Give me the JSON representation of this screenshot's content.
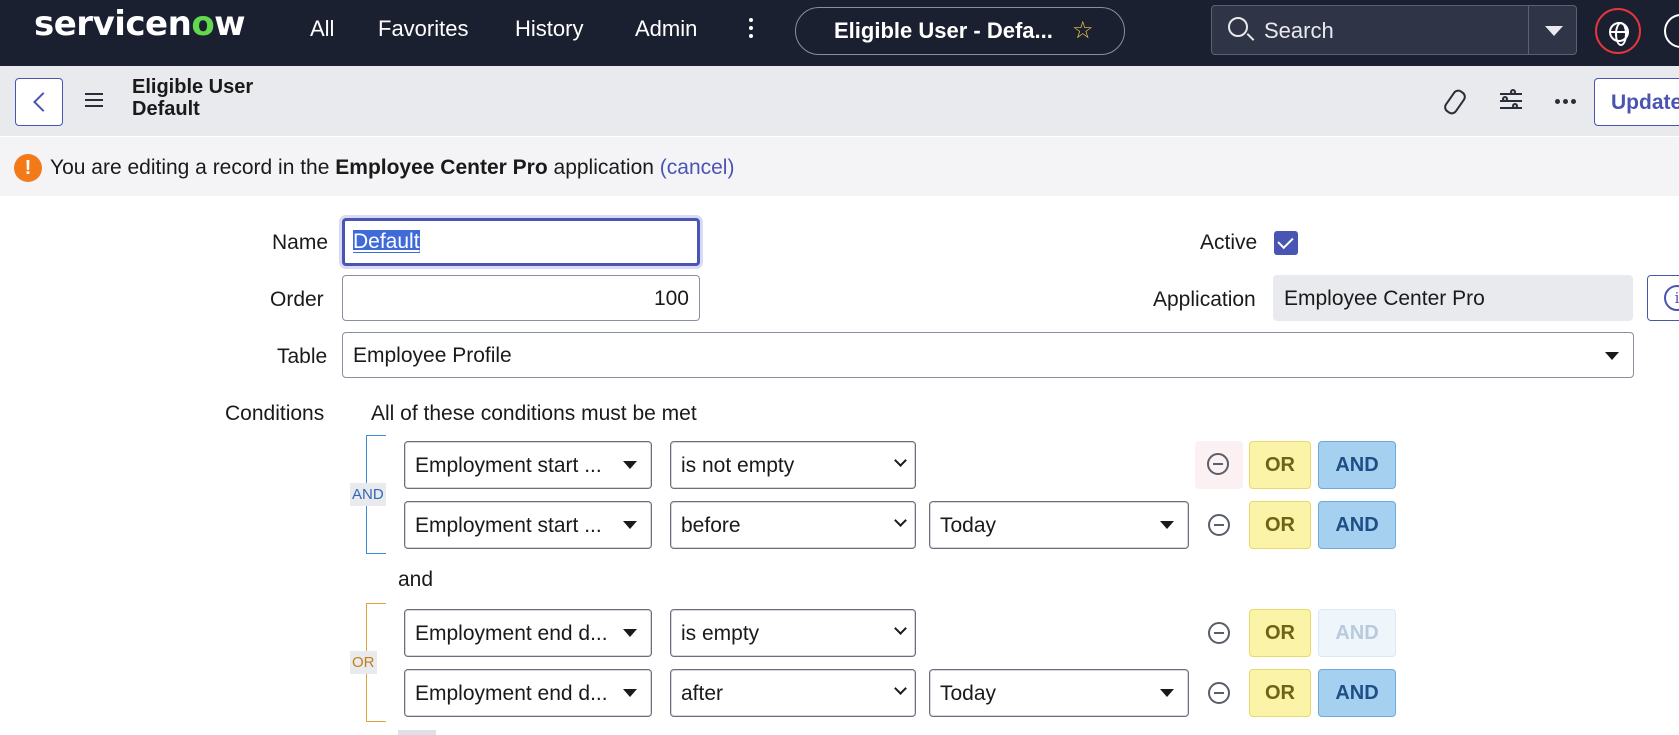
{
  "nav": {
    "logo_prefix": "servicen",
    "logo_o": "o",
    "logo_suffix": "w",
    "links": [
      "All",
      "Favorites",
      "History",
      "Admin"
    ],
    "record_pill": "Eligible User - Defa...",
    "search_placeholder": "Search"
  },
  "header": {
    "title_line1": "Eligible User",
    "title_line2": "Default",
    "update_label": "Update"
  },
  "notice": {
    "prefix": "You are editing a record in the",
    "app": "Employee Center Pro",
    "suffix": "application",
    "cancel": "(cancel)"
  },
  "form": {
    "name_label": "Name",
    "name_value": "Default",
    "order_label": "Order",
    "order_value": "100",
    "table_label": "Table",
    "table_value": "Employee Profile",
    "active_label": "Active",
    "active_checked": true,
    "application_label": "Application",
    "application_value": "Employee Center Pro",
    "conditions_label": "Conditions",
    "conditions_heading": "All of these conditions must be met"
  },
  "conditions": {
    "group1_tag": "AND",
    "group2_tag": "OR",
    "between_groups": "and",
    "rows": [
      {
        "field": "Employment start ...",
        "operator": "is not empty",
        "value": ""
      },
      {
        "field": "Employment start ...",
        "operator": "before",
        "value": "Today"
      },
      {
        "field": "Employment end d...",
        "operator": "is empty",
        "value": ""
      },
      {
        "field": "Employment end d...",
        "operator": "after",
        "value": "Today"
      }
    ],
    "or_label": "OR",
    "and_label": "AND"
  },
  "colors": {
    "nav_bg": "#1b2030",
    "accent": "#4a54b3",
    "warning": "#f27a19",
    "or_button": "#fbf3a8",
    "and_button": "#a6d0f0"
  }
}
